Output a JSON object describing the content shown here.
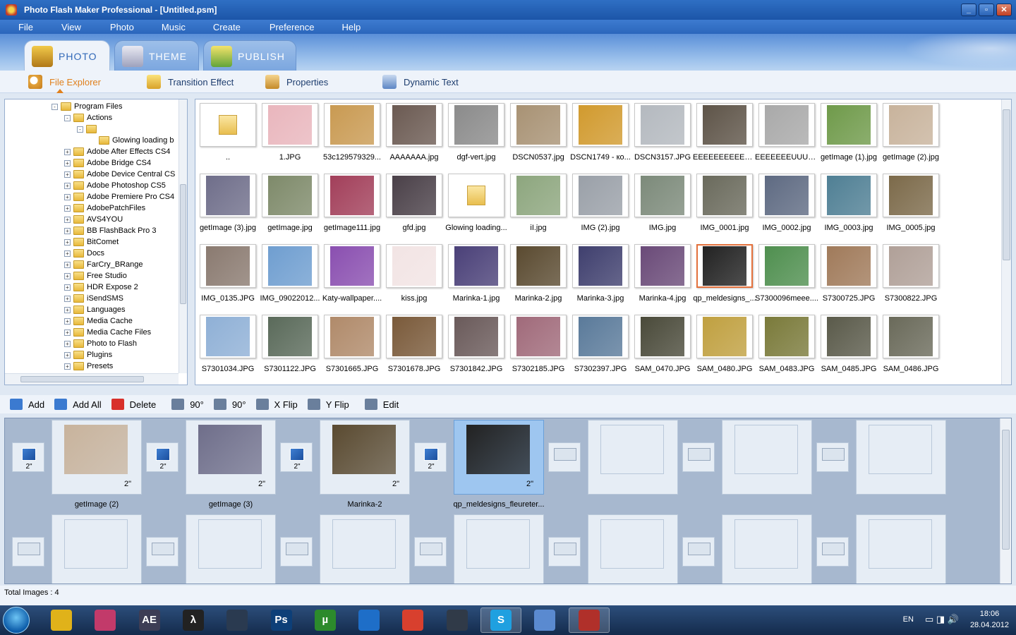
{
  "window": {
    "title": "Photo Flash Maker Professional - [Untitled.psm]",
    "buttons": [
      "minimize-icon",
      "maximize-icon",
      "close-icon"
    ]
  },
  "menu": [
    "File",
    "View",
    "Photo",
    "Music",
    "Create",
    "Preference",
    "Help"
  ],
  "main_tabs": [
    {
      "label": "PHOTO",
      "active": true
    },
    {
      "label": "THEME",
      "active": false
    },
    {
      "label": "PUBLISH",
      "active": false
    }
  ],
  "sub_tabs": [
    {
      "label": "File Explorer",
      "active": true,
      "icon": "magnifier-icon"
    },
    {
      "label": "Transition Effect",
      "active": false,
      "icon": "star-icon"
    },
    {
      "label": "Properties",
      "active": false,
      "icon": "printer-icon"
    },
    {
      "label": "Dynamic Text",
      "active": false,
      "icon": "text-icon"
    }
  ],
  "tree": [
    {
      "label": "Program Files",
      "level": 0,
      "expander": "-"
    },
    {
      "label": "Actions",
      "level": 1,
      "expander": "-"
    },
    {
      "label": "",
      "level": 2,
      "expander": "-"
    },
    {
      "label": "Glowing loading b",
      "level": 3,
      "expander": ""
    },
    {
      "label": "Adobe After Effects CS4",
      "level": 1,
      "expander": "+"
    },
    {
      "label": "Adobe Bridge CS4",
      "level": 1,
      "expander": "+"
    },
    {
      "label": "Adobe Device Central CS",
      "level": 1,
      "expander": "+"
    },
    {
      "label": "Adobe Photoshop CS5",
      "level": 1,
      "expander": "+"
    },
    {
      "label": "Adobe Premiere Pro CS4",
      "level": 1,
      "expander": "+"
    },
    {
      "label": "AdobePatchFiles",
      "level": 1,
      "expander": "+"
    },
    {
      "label": "AVS4YOU",
      "level": 1,
      "expander": "+"
    },
    {
      "label": "BB FlashBack Pro 3",
      "level": 1,
      "expander": "+"
    },
    {
      "label": "BitComet",
      "level": 1,
      "expander": "+"
    },
    {
      "label": "Docs",
      "level": 1,
      "expander": "+"
    },
    {
      "label": "FarCry_BRange",
      "level": 1,
      "expander": "+"
    },
    {
      "label": "Free Studio",
      "level": 1,
      "expander": "+"
    },
    {
      "label": "HDR Expose 2",
      "level": 1,
      "expander": "+"
    },
    {
      "label": "iSendSMS",
      "level": 1,
      "expander": "+"
    },
    {
      "label": "Languages",
      "level": 1,
      "expander": "+"
    },
    {
      "label": "Media Cache",
      "level": 1,
      "expander": "+"
    },
    {
      "label": "Media Cache Files",
      "level": 1,
      "expander": "+"
    },
    {
      "label": "Photo to Flash",
      "level": 1,
      "expander": "+"
    },
    {
      "label": "Plugins",
      "level": 1,
      "expander": "+"
    },
    {
      "label": "Presets",
      "level": 1,
      "expander": "+"
    }
  ],
  "thumbnails": [
    {
      "name": "..",
      "kind": "folder"
    },
    {
      "name": "1.JPG",
      "color": "#e9b6bd"
    },
    {
      "name": "53c129579329...",
      "color": "#c99a52"
    },
    {
      "name": "AAAAAAA.jpg",
      "color": "#6b5a52"
    },
    {
      "name": "dgf-vert.jpg",
      "color": "#8b8b8b"
    },
    {
      "name": "DSCN0537.jpg",
      "color": "#a89274"
    },
    {
      "name": "DSCN1749 - ко...",
      "color": "#d19a2e"
    },
    {
      "name": "DSCN3157.JPG",
      "color": "#b4b9bf"
    },
    {
      "name": "EEEEEEEEEEEE...",
      "color": "#5e5448"
    },
    {
      "name": "EEEEEEEUUUU...",
      "color": "#a9a9a9"
    },
    {
      "name": "getImage (1).jpg",
      "color": "#6f9a4a"
    },
    {
      "name": "getImage (2).jpg",
      "color": "#c8b39c"
    },
    {
      "name": "getImage (3).jpg",
      "color": "#6f6e8a"
    },
    {
      "name": "getImage.jpg",
      "color": "#7e8a6a"
    },
    {
      "name": "getImage111.jpg",
      "color": "#a23f5a"
    },
    {
      "name": "gfd.jpg",
      "color": "#4a4048"
    },
    {
      "name": "Glowing loading...",
      "kind": "folder"
    },
    {
      "name": "iI.jpg",
      "color": "#8da67e"
    },
    {
      "name": "IMG (2).jpg",
      "color": "#9aa0a8"
    },
    {
      "name": "IMG.jpg",
      "color": "#7c8a7a"
    },
    {
      "name": "IMG_0001.jpg",
      "color": "#6a6a5c"
    },
    {
      "name": "IMG_0002.jpg",
      "color": "#5e6a82"
    },
    {
      "name": "IMG_0003.jpg",
      "color": "#4f7f94"
    },
    {
      "name": "IMG_0005.jpg",
      "color": "#7c6a4a"
    },
    {
      "name": "IMG_0135.JPG",
      "color": "#8a7a70"
    },
    {
      "name": "IMG_09022012...",
      "color": "#6f9ed0"
    },
    {
      "name": "Katy-wallpaper....",
      "color": "#8a4fb0"
    },
    {
      "name": "kiss.jpg",
      "color": "#f2e4e4"
    },
    {
      "name": "Marinka-1.jpg",
      "color": "#4a4078"
    },
    {
      "name": "Marinka-2.jpg",
      "color": "#5a4a30"
    },
    {
      "name": "Marinka-3.jpg",
      "color": "#3f3f6e"
    },
    {
      "name": "Marinka-4.jpg",
      "color": "#6a4a78"
    },
    {
      "name": "qp_meldesigns_...",
      "color": "#222222",
      "selected": true
    },
    {
      "name": "S7300096meee....",
      "color": "#4f8f4f"
    },
    {
      "name": "S7300725.JPG",
      "color": "#a07a5a"
    },
    {
      "name": "S7300822.JPG",
      "color": "#b0a098"
    },
    {
      "name": "S7301034.JPG",
      "color": "#8fb0d6"
    },
    {
      "name": "S7301122.JPG",
      "color": "#5a6a5a"
    },
    {
      "name": "S7301665.JPG",
      "color": "#b08a6a"
    },
    {
      "name": "S7301678.JPG",
      "color": "#7a5a3a"
    },
    {
      "name": "S7301842.JPG",
      "color": "#6a5a5a"
    },
    {
      "name": "S7302185.JPG",
      "color": "#a06a7a"
    },
    {
      "name": "S7302397.JPG",
      "color": "#5a7a9a"
    },
    {
      "name": "SAM_0470.JPG",
      "color": "#4a4a3a"
    },
    {
      "name": "SAM_0480.JPG",
      "color": "#c0a040"
    },
    {
      "name": "SAM_0483.JPG",
      "color": "#7a7a3a"
    },
    {
      "name": "SAM_0485.JPG",
      "color": "#5a5a4a"
    },
    {
      "name": "SAM_0486.JPG",
      "color": "#6a6a5a"
    }
  ],
  "actions": [
    {
      "label": "Add",
      "icon": "add-image-icon"
    },
    {
      "label": "Add All",
      "icon": "add-all-icon"
    },
    {
      "label": "Delete",
      "icon": "delete-icon"
    },
    {
      "label": "90°",
      "icon": "rotate-left-icon"
    },
    {
      "label": "90°",
      "icon": "rotate-right-icon"
    },
    {
      "label": "X Flip",
      "icon": "x-flip-icon"
    },
    {
      "label": "Y Flip",
      "icon": "y-flip-icon"
    },
    {
      "label": "Edit",
      "icon": "edit-icon"
    }
  ],
  "storyboard": {
    "slides": [
      {
        "label": "getImage (2)",
        "duration": "2\"",
        "color": "#c8b39c"
      },
      {
        "label": "getImage (3)",
        "duration": "2\"",
        "color": "#6f6e8a"
      },
      {
        "label": "Marinka-2",
        "duration": "2\"",
        "color": "#5a4a30"
      },
      {
        "label": "qp_meldesigns_fleureter...",
        "duration": "2\"",
        "color": "#222222",
        "selected": true
      }
    ],
    "transition_duration": "2\""
  },
  "status": {
    "total_images": "Total Images : 4"
  },
  "taskbar": {
    "apps": [
      {
        "name": "sticky-notes-icon",
        "color": "#e0b21a",
        "glyph": ""
      },
      {
        "name": "color-picker-icon",
        "color": "#c23a6a",
        "glyph": ""
      },
      {
        "name": "after-effects-icon",
        "color": "#3d3d55",
        "glyph": "AE"
      },
      {
        "name": "half-life-icon",
        "color": "#222222",
        "glyph": "λ"
      },
      {
        "name": "counter-strike-icon",
        "color": "#2a3a50",
        "glyph": ""
      },
      {
        "name": "photoshop-icon",
        "color": "#0d3f78",
        "glyph": "Ps"
      },
      {
        "name": "utorrent-icon",
        "color": "#2c8a2c",
        "glyph": "µ"
      },
      {
        "name": "teamviewer-icon",
        "color": "#1e6ec8",
        "glyph": ""
      },
      {
        "name": "chrome-icon",
        "color": "#d8402e",
        "glyph": ""
      },
      {
        "name": "camera-icon",
        "color": "#303a48",
        "glyph": ""
      },
      {
        "name": "skype-icon",
        "color": "#1fa0e0",
        "glyph": "S",
        "active": true
      },
      {
        "name": "paint-icon",
        "color": "#5a8ad0",
        "glyph": ""
      },
      {
        "name": "photo-flash-maker-icon",
        "color": "#b0302a",
        "glyph": "",
        "active": true
      }
    ],
    "lang": "EN",
    "time": "18:06",
    "date": "28.04.2012"
  }
}
